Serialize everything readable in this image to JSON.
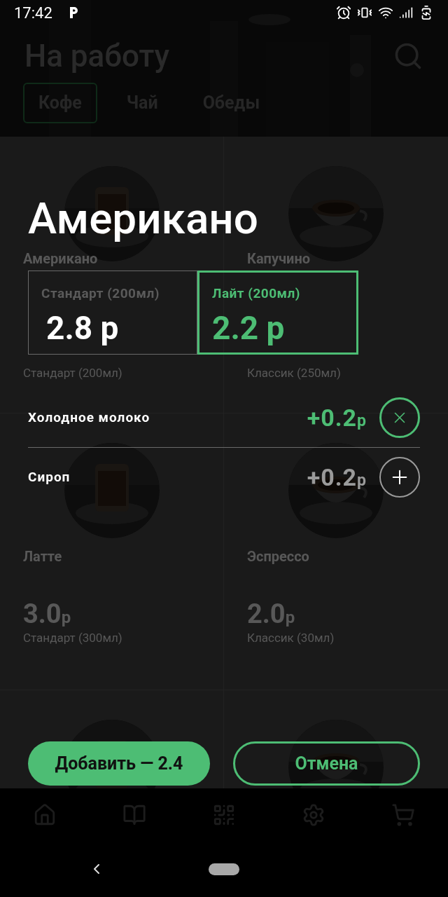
{
  "status_bar": {
    "time": "17:42"
  },
  "header": {
    "title": "На работу",
    "tabs": [
      {
        "label": "Кофе",
        "selected": true
      },
      {
        "label": "Чай",
        "selected": false
      },
      {
        "label": "Обеды",
        "selected": false
      }
    ]
  },
  "products": [
    {
      "kind": "product",
      "name": "Американо",
      "size": "Стандарт (200мл)"
    },
    {
      "kind": "product",
      "name": "Капучино",
      "size": "Классик (250мл)"
    },
    {
      "kind": "product",
      "name": "Латте",
      "price": "3.0",
      "currency": "р",
      "size": "Стандарт (300мл)"
    },
    {
      "kind": "product",
      "name": "Эспрессо",
      "price": "2.0",
      "currency": "р",
      "size": "Классик (30мл)"
    },
    {
      "kind": "picture"
    },
    {
      "kind": "picture"
    }
  ],
  "modal": {
    "title": "Американо",
    "options": [
      {
        "label": "Стандарт (200мл)",
        "price": "2.8 р",
        "selected": false
      },
      {
        "label": "Лайт (200мл)",
        "price": "2.2 р",
        "selected": true
      }
    ],
    "addons": [
      {
        "name": "Холодное молоко",
        "price": "+0.2",
        "currency": "р",
        "added": true
      },
      {
        "name": "Сироп",
        "price": "+0.2",
        "currency": "р",
        "added": false
      }
    ],
    "add_button": "Добавить — 2.4",
    "cancel_button": "Отмена"
  }
}
